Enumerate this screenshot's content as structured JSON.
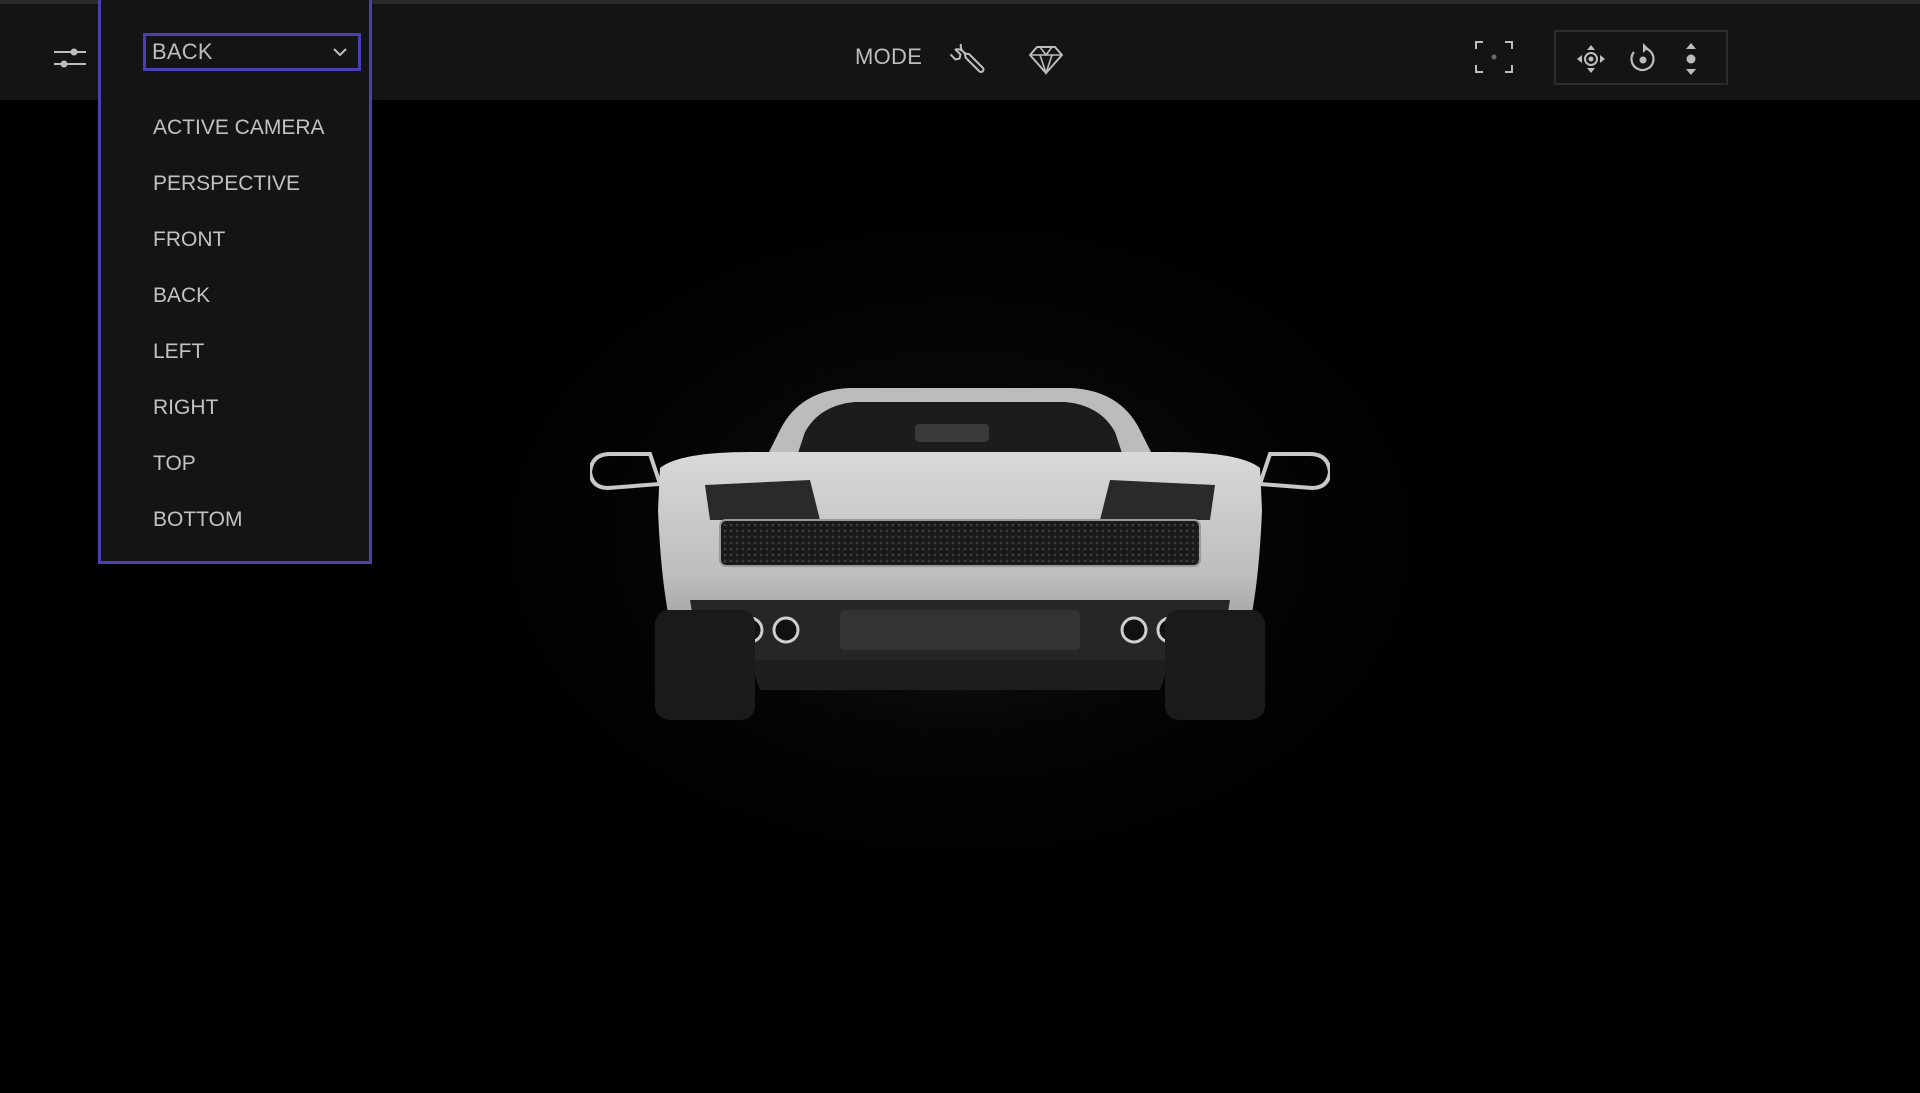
{
  "toolbar": {
    "mode_label": "MODE",
    "icons": {
      "settings": "sliders-icon",
      "wrench": "wrench-icon",
      "gem": "diamond-icon",
      "frame": "focus-frame-icon",
      "pan": "pan-icon",
      "orbit": "orbit-icon",
      "dolly": "dolly-icon"
    }
  },
  "camera_dropdown": {
    "selected": "BACK",
    "options": [
      "ACTIVE CAMERA",
      "PERSPECTIVE",
      "FRONT",
      "BACK",
      "LEFT",
      "RIGHT",
      "TOP",
      "BOTTOM"
    ]
  },
  "colors": {
    "accent": "#4a3fb3",
    "toolbar_bg": "#141414",
    "viewport_bg": "#000000"
  }
}
